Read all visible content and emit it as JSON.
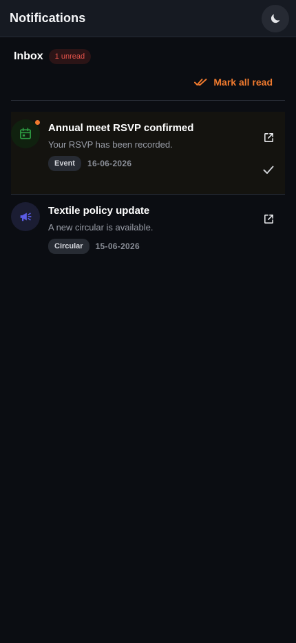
{
  "header": {
    "title": "Notifications",
    "theme_toggle_icon": "moon-icon"
  },
  "inbox": {
    "title": "Inbox",
    "unread_badge": "1 unread",
    "mark_all_label": "Mark all read",
    "mark_all_icon": "double-check-icon"
  },
  "colors": {
    "accent": "#f07a2e",
    "unread_badge_text": "#e5534b",
    "event_icon": "#2e9e43",
    "circular_icon": "#5b5ce6"
  },
  "notifications": [
    {
      "title": "Annual meet RSVP confirmed",
      "body": "Your RSVP has been recorded.",
      "tag": "Event",
      "date": "16-06-2026",
      "icon": "calendar-icon",
      "unread": true
    },
    {
      "title": "Textile policy update",
      "body": "A new circular is available.",
      "tag": "Circular",
      "date": "15-06-2026",
      "icon": "megaphone-icon",
      "unread": false
    }
  ]
}
